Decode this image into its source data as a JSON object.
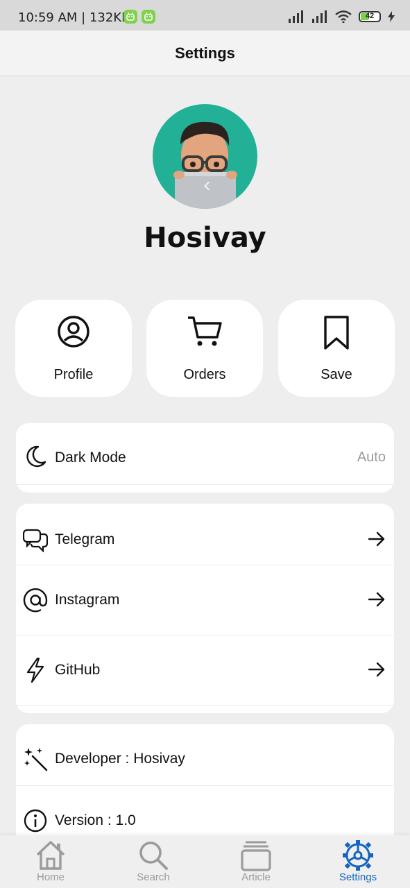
{
  "status_bar": {
    "time": "10:59 AM | 132KB",
    "battery": "42"
  },
  "app_bar": {
    "title": "Settings"
  },
  "profile": {
    "name": "Hosivay"
  },
  "quick_actions": [
    {
      "label": "Profile",
      "icon": "account-circle-icon"
    },
    {
      "label": "Orders",
      "icon": "cart-icon"
    },
    {
      "label": "Save",
      "icon": "bookmark-icon"
    }
  ],
  "appearance": {
    "dark_mode_label": "Dark Mode",
    "dark_mode_value": "Auto"
  },
  "links": [
    {
      "label": "Telegram",
      "icon": "chat-bubbles-icon"
    },
    {
      "label": "Instagram",
      "icon": "at-sign-icon"
    },
    {
      "label": "GitHub",
      "icon": "lightning-icon"
    }
  ],
  "about": {
    "developer": "Developer : Hosivay",
    "version": "Version : 1.0"
  },
  "bottom_nav": [
    {
      "label": "Home",
      "icon": "home-icon",
      "active": false
    },
    {
      "label": "Search",
      "icon": "search-icon",
      "active": false
    },
    {
      "label": "Article",
      "icon": "article-stack-icon",
      "active": false
    },
    {
      "label": "Settings",
      "icon": "settings-gear-icon",
      "active": true
    }
  ],
  "colors": {
    "accent": "#1565c0",
    "avatar_bg": "#22b097",
    "page_bg": "#eeeeee",
    "card_bg": "#ffffff"
  }
}
